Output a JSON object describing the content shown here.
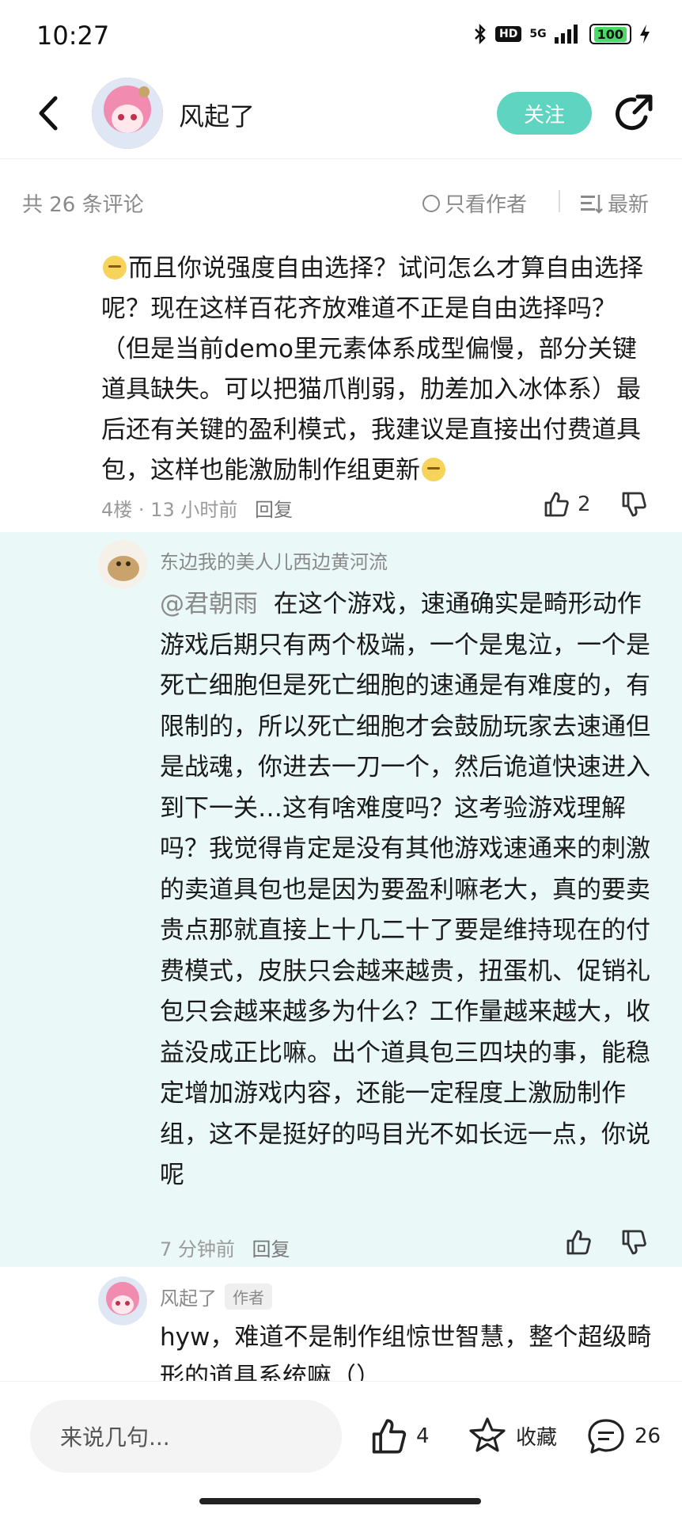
{
  "status_bar": {
    "time": "10:27",
    "hd": "HD",
    "network": "5G",
    "battery": "100"
  },
  "header": {
    "name": "风起了",
    "follow_label": "关注"
  },
  "comments_bar": {
    "count_text": "共 26 条评论",
    "author_only": "只看作者",
    "sort": "最新"
  },
  "comment1": {
    "text": "而且你说强度自由选择？试问怎么才算自由选择呢？现在这样百花齐放难道不正是自由选择吗？（但是当前demo里元素体系成型偏慢，部分关键道具缺失。可以把猫爪削弱，肋差加入冰体系）最后还有关键的盈利模式，我建议是直接出付费道具包，这样也能激励制作组更新",
    "floor": "4楼",
    "time": "13 小时前",
    "reply": "回复",
    "likes": "2"
  },
  "reply1": {
    "username": "东边我的美人儿西边黄河流",
    "mention": "@君朝雨",
    "text": "在这个游戏，速通确实是畸形动作游戏后期只有两个极端，一个是鬼泣，一个是死亡细胞但是死亡细胞的速通是有难度的，有限制的，所以死亡细胞才会鼓励玩家去速通但是战魂，你进去一刀一个，然后诡道快速进入到下一关…这有啥难度吗？这考验游戏理解吗？我觉得肯定是没有其他游戏速通来的刺激的卖道具包也是因为要盈利嘛老大，真的要卖贵点那就直接上十几二十了要是维持现在的付费模式，皮肤只会越来越贵，扭蛋机、促销礼包只会越来越多为什么？工作量越来越大，收益没成正比嘛。出个道具包三四块的事，能稳定增加游戏内容，还能一定程度上激励制作组，这不是挺好的吗目光不如长远一点，你说呢",
    "time": "7 分钟前",
    "reply": "回复"
  },
  "reply2": {
    "username": "风起了",
    "tag": "作者",
    "text": "hyw，难道不是制作组惊世智慧，整个超级畸形的道具系统嘛（）"
  },
  "bottom_bar": {
    "input_placeholder": "来说几句...",
    "likes": "4",
    "favorite": "收藏",
    "comments": "26"
  },
  "colors": {
    "accent": "#5fd4c0",
    "reply_bg": "#eaf8f8",
    "muted": "#8a8a8a"
  },
  "icons": [
    "back-icon",
    "share-icon",
    "radio-icon",
    "sort-icon",
    "thumb-up-icon",
    "thumb-down-icon",
    "star-icon",
    "comment-icon",
    "bluetooth-icon",
    "signal-icon",
    "charging-icon"
  ]
}
